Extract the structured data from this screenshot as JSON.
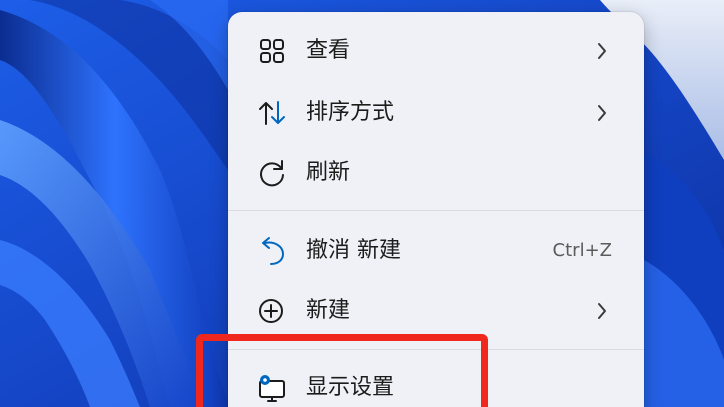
{
  "context_menu": {
    "items": [
      {
        "label": "查看",
        "icon": "grid-view-icon",
        "has_submenu": true
      },
      {
        "label": "排序方式",
        "icon": "sort-icon",
        "has_submenu": true
      },
      {
        "label": "刷新",
        "icon": "refresh-icon",
        "has_submenu": false
      },
      {
        "label": "撤消 新建",
        "icon": "undo-icon",
        "shortcut": "Ctrl+Z"
      },
      {
        "label": "新建",
        "icon": "new-plus-icon",
        "has_submenu": true
      },
      {
        "label": "显示设置",
        "icon": "display-settings-icon",
        "has_submenu": false
      }
    ]
  },
  "colors": {
    "accent": "#0067c0",
    "highlight_box": "#f0271c",
    "menu_background": "#eff1f6"
  }
}
